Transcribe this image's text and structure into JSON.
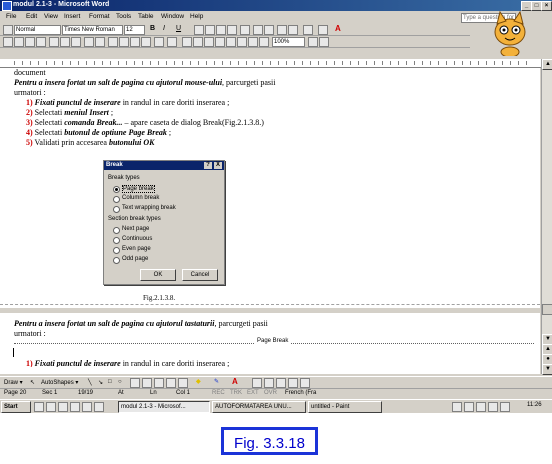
{
  "window": {
    "title": "modul 2.1-3 - Microsoft Word"
  },
  "menu": [
    "File",
    "Edit",
    "View",
    "Insert",
    "Format",
    "Tools",
    "Table",
    "Window",
    "Help"
  ],
  "help_box": {
    "placeholder": "Type a question for help"
  },
  "formatting": {
    "style": "Normal",
    "font": "Times New Roman",
    "size": "12",
    "zoom": "100%"
  },
  "document": {
    "line0": "document",
    "intro1_bold": "Pentru a insera fortat un salt de pagina cu ajutorul mouse-ului",
    "intro1_rest": ", parcurgeti pasii",
    "intro1_b": "urmatori :",
    "steps": [
      {
        "n": "1)",
        "bold": "Fixati punctul de inserare",
        "rest": " in randul in care doriti inserarea ;"
      },
      {
        "n": "2)",
        "bold": "",
        "pre": "Selectati ",
        "bold2": "meniul Insert",
        "rest": " ;"
      },
      {
        "n": "3)",
        "pre": "Selectati ",
        "bold2": "comanda Break...",
        "rest": " – apare caseta de dialog Break(Fig.2.1.3.8.)"
      },
      {
        "n": "4)",
        "pre": "Selectati ",
        "bold2": "butonul de optiune Page Break",
        "rest": " ;"
      },
      {
        "n": "5)",
        "pre": "Validati prin accesarea ",
        "bold2": "butonului OK",
        "rest": ""
      }
    ],
    "fig_label": "Fig.2.1.3.8.",
    "intro2_bold": "Pentru a insera fortat un salt de pagina cu ajutorul tastaturii",
    "intro2_rest": ", parcurgeti pasii",
    "intro2_b": "urmatori :",
    "page_break": "Page Break",
    "step_last": {
      "n": "1)",
      "bold": "Fixati punctul de inserare",
      "rest": " in randul in care doriti inserarea ;"
    }
  },
  "dialog": {
    "title": "Break",
    "help": "?",
    "close": "X",
    "group1": "Break types",
    "options1": [
      "Page break",
      "Column break",
      "Text wrapping break"
    ],
    "group2": "Section break types",
    "options2": [
      "Next page",
      "Continuous",
      "Even page",
      "Odd page"
    ],
    "ok": "OK",
    "cancel": "Cancel"
  },
  "drawbar": {
    "draw": "Draw ▾",
    "autoshapes": "AutoShapes ▾"
  },
  "status": {
    "page": "Page  20",
    "sec": "Sec  1",
    "pos": "19/19",
    "at": "At",
    "ln": "Ln",
    "col": "Col  1",
    "rec": "REC",
    "trk": "TRK",
    "ext": "EXT",
    "ovr": "OVR",
    "lang": "French (Fra"
  },
  "taskbar": {
    "start": "Start",
    "tasks": [
      "modul 2.1-3 - Microsof...",
      "AUTOFORMATAREA UNU...",
      "untitled - Paint"
    ],
    "clock": "11:26"
  },
  "caption": "Fig. 3.3.18"
}
